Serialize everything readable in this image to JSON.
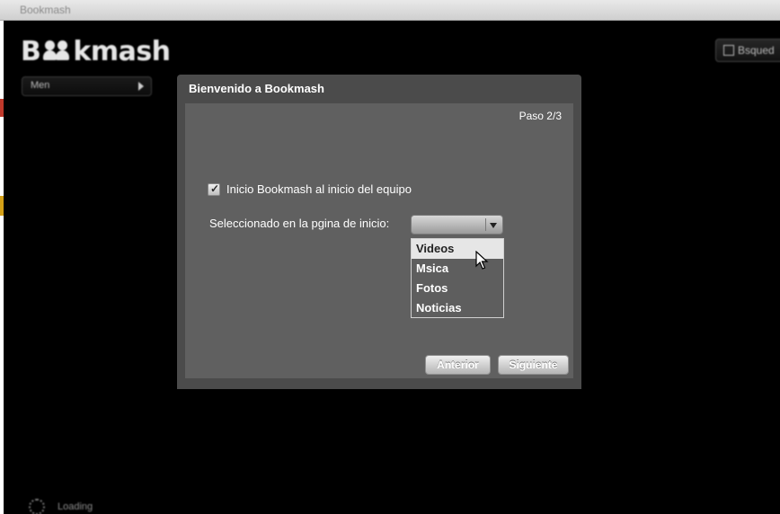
{
  "window": {
    "title": "Bookmash"
  },
  "logo": {
    "first_letter": "B",
    "rest": "kmash"
  },
  "sidebar": {
    "menu_label": "Men"
  },
  "header": {
    "right_button_label": "Bsqued"
  },
  "status": {
    "loading_label": "Loading"
  },
  "dialog": {
    "title": "Bienvenido a Bookmash",
    "step": "Paso 2/3",
    "checkbox_label": "Inicio Bookmash al inicio del equipo",
    "checkbox_checked": true,
    "select_label": "Seleccionado en la pgina de inicio:",
    "select_value": "",
    "options": [
      "Videos",
      "Msica",
      "Fotos",
      "Noticias"
    ],
    "highlighted_option": "Videos",
    "prev_button": "Anterior",
    "next_button": "Siguiente"
  },
  "colors": {
    "app_background": "#000000",
    "dialog_background": "#4b4b4b",
    "dialog_inner": "#606060",
    "highlight": "#e6e6e6"
  }
}
